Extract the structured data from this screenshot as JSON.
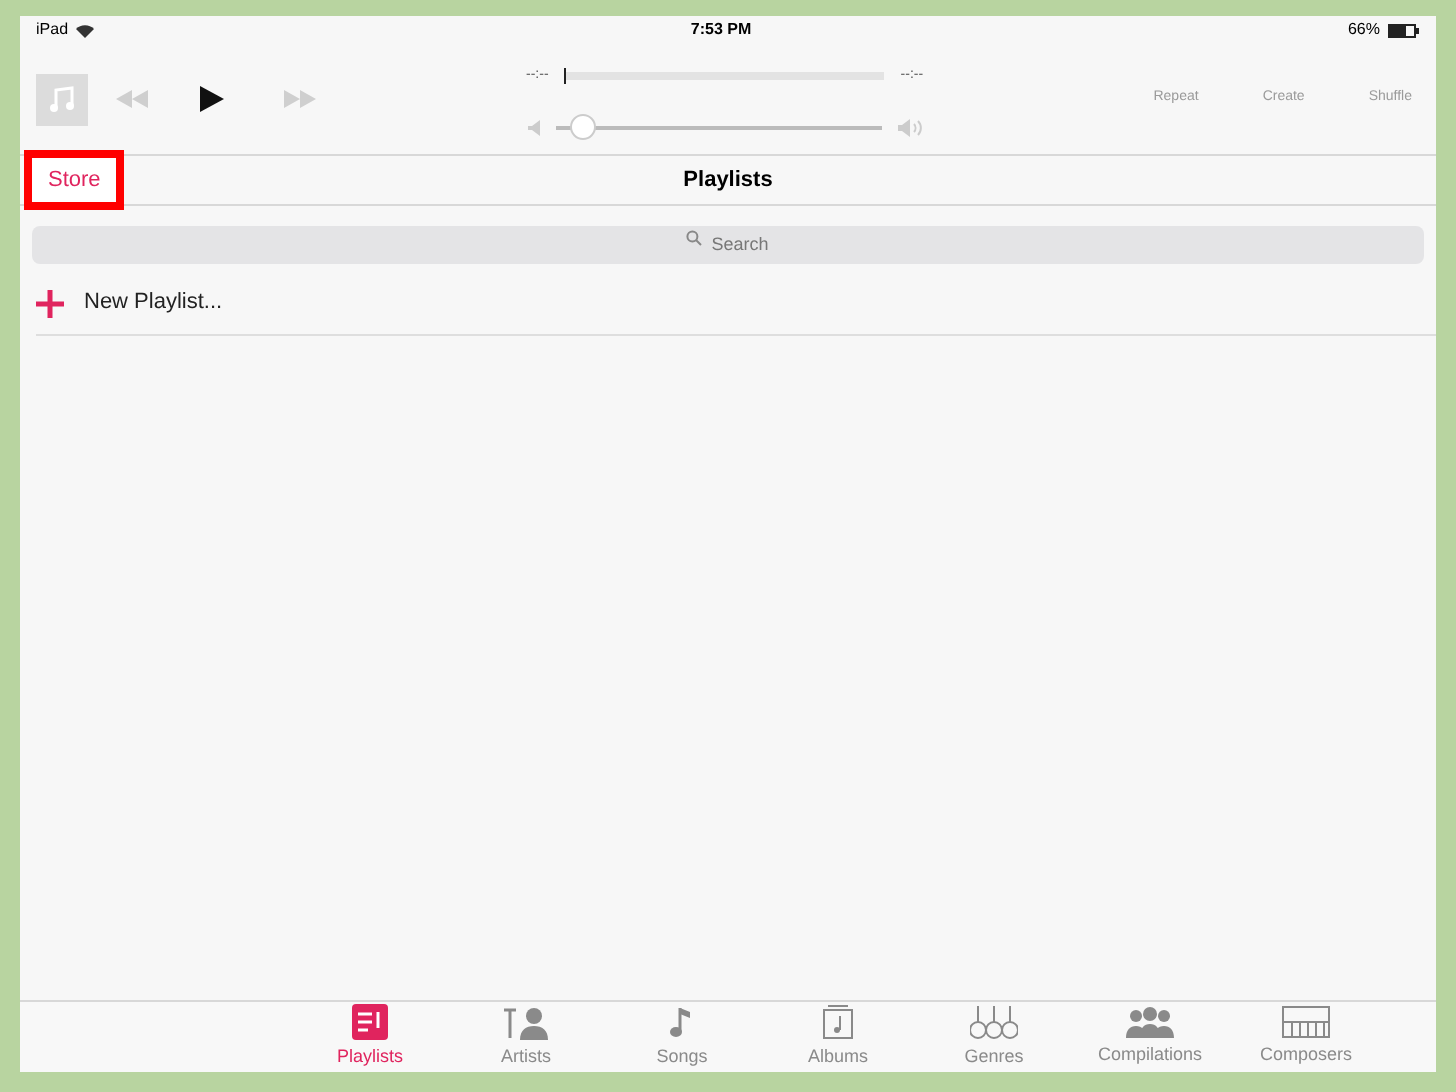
{
  "status_bar": {
    "device": "iPad",
    "time": "7:53 PM",
    "battery": "66%"
  },
  "player": {
    "elapsed": "--:--",
    "remaining": "--:--",
    "progress": {
      "level": 0.0
    },
    "volume": {
      "level": 0.05
    },
    "actions": [
      "Repeat",
      "Create",
      "Shuffle"
    ]
  },
  "nav_bar": {
    "back": "Store",
    "title": "Playlists",
    "highlighted": true
  },
  "search": {
    "placeholder": "Search"
  },
  "list": [
    {
      "label": "New Playlist..."
    }
  ],
  "tabs": [
    {
      "label": "Playlists",
      "selected": true
    },
    {
      "label": "Artists",
      "selected": false
    },
    {
      "label": "Songs",
      "selected": false
    },
    {
      "label": "Albums",
      "selected": false
    },
    {
      "label": "Genres",
      "selected": false
    },
    {
      "label": "Compilations",
      "selected": false
    },
    {
      "label": "Composers",
      "selected": false
    }
  ]
}
